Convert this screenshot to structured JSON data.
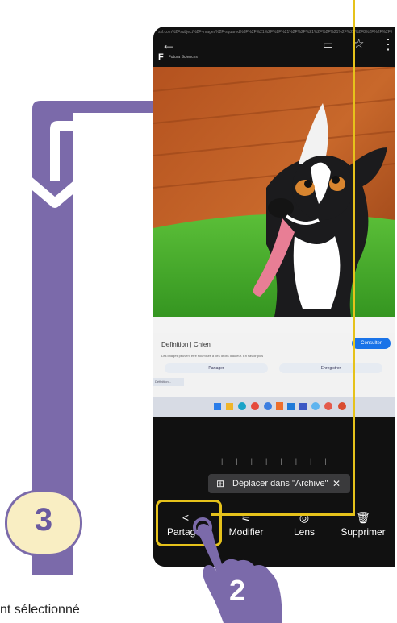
{
  "browser": {
    "url_text": "ssl.com%2Fsubject%2F-images%2F-squared%3F%2F%21%2F%2F%21%2F%2F%21%2F%2F%21%2F%2F%2F8%2F%2F%2F%2F%2F%2F%2F%2F%2F%2F the dog photo",
    "site_name": "Futura Sciences",
    "site_logo": "F"
  },
  "caption": {
    "title": "Definition | Chien",
    "consult_button": "Consulter",
    "note": "Les images peuvent être soumises à des droits d'auteur. En savoir plus",
    "share_button": "Partager",
    "save_button": "Enregistrer",
    "small_tab": "Définition..."
  },
  "snackbar": {
    "label": "Déplacer dans \"Archive\"",
    "close": "✕"
  },
  "actions": {
    "share": "Partager",
    "edit": "Modifier",
    "lens": "Lens",
    "delete": "Supprimer"
  },
  "badges": {
    "step3": "3",
    "step2": "2"
  },
  "footer": {
    "text": "nt sélectionné"
  },
  "colors": {
    "purple": "#7b6aaa",
    "yellow": "#e6c21b",
    "badge_fill": "#f9eec3"
  }
}
